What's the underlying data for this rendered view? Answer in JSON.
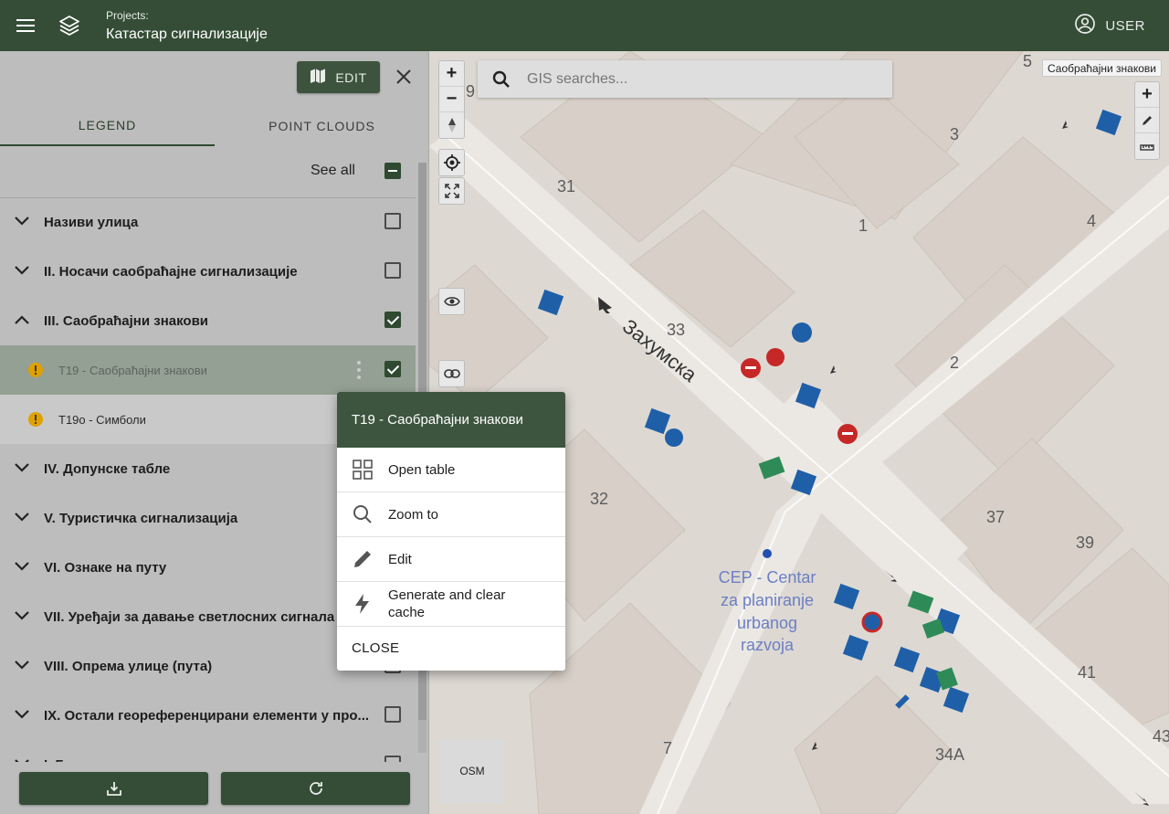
{
  "header": {
    "projects_label": "Projects:",
    "project_name": "Катастар сигнализације",
    "user_label": "USER"
  },
  "panel": {
    "edit_label": "EDIT",
    "tabs": [
      {
        "label": "LEGEND",
        "active": true
      },
      {
        "label": "POINT CLOUDS",
        "active": false
      }
    ],
    "see_all_label": "See all",
    "layers": [
      {
        "label": "Називи улица",
        "expanded": false,
        "checked": false
      },
      {
        "label": "II. Носачи саобраћајне сигнализације",
        "expanded": false,
        "checked": false
      },
      {
        "label": "III. Саобраћајни знакови",
        "expanded": true,
        "checked": true
      },
      {
        "label": "T19 - Саобраћајни знакови",
        "sublayer": true,
        "selected": true,
        "checked": true
      },
      {
        "label": "T19o - Симболи",
        "sublayer": true,
        "selected": false
      },
      {
        "label": "IV. Допунске табле",
        "expanded": false
      },
      {
        "label": "V. Туристичка сигнализација",
        "expanded": false
      },
      {
        "label": "VI. Ознаке на путу",
        "expanded": false
      },
      {
        "label": "VII. Уређаји за давање светлосних сигнала",
        "expanded": false
      },
      {
        "label": "VIII. Опрема улице (пута)",
        "expanded": false
      },
      {
        "label": "IX. Остали геореференцирани елементи у про...",
        "expanded": false,
        "checked": false
      },
      {
        "label": "I. Г...",
        "expanded": false
      }
    ]
  },
  "map": {
    "search_placeholder": "GIS searches...",
    "layer_tooltip": "Саобраћајни знакови",
    "basemap_label": "OSM",
    "street_label": "Захумска",
    "poi_label": "CEP - Centar za planiranje urbanog razvoja",
    "house_numbers": [
      "9",
      "31",
      "3",
      "1",
      "4",
      "33",
      "2",
      "32",
      "37",
      "39",
      "41",
      "7",
      "34A",
      "43",
      "5"
    ]
  },
  "context_menu": {
    "title": "T19 - Саобраћајни знакови",
    "items": [
      {
        "label": "Open table",
        "icon": "table-icon"
      },
      {
        "label": "Zoom to",
        "icon": "search-icon"
      },
      {
        "label": "Edit",
        "icon": "pencil-icon"
      },
      {
        "label": "Generate and clear cache",
        "icon": "lightning-icon"
      }
    ],
    "close_label": "CLOSE"
  },
  "colors": {
    "primary": "#354d36",
    "panel_bg": "#bdbdbd",
    "sign_blue": "#1f5fa8",
    "sign_red": "#c62828",
    "sign_green": "#2e8b57"
  }
}
